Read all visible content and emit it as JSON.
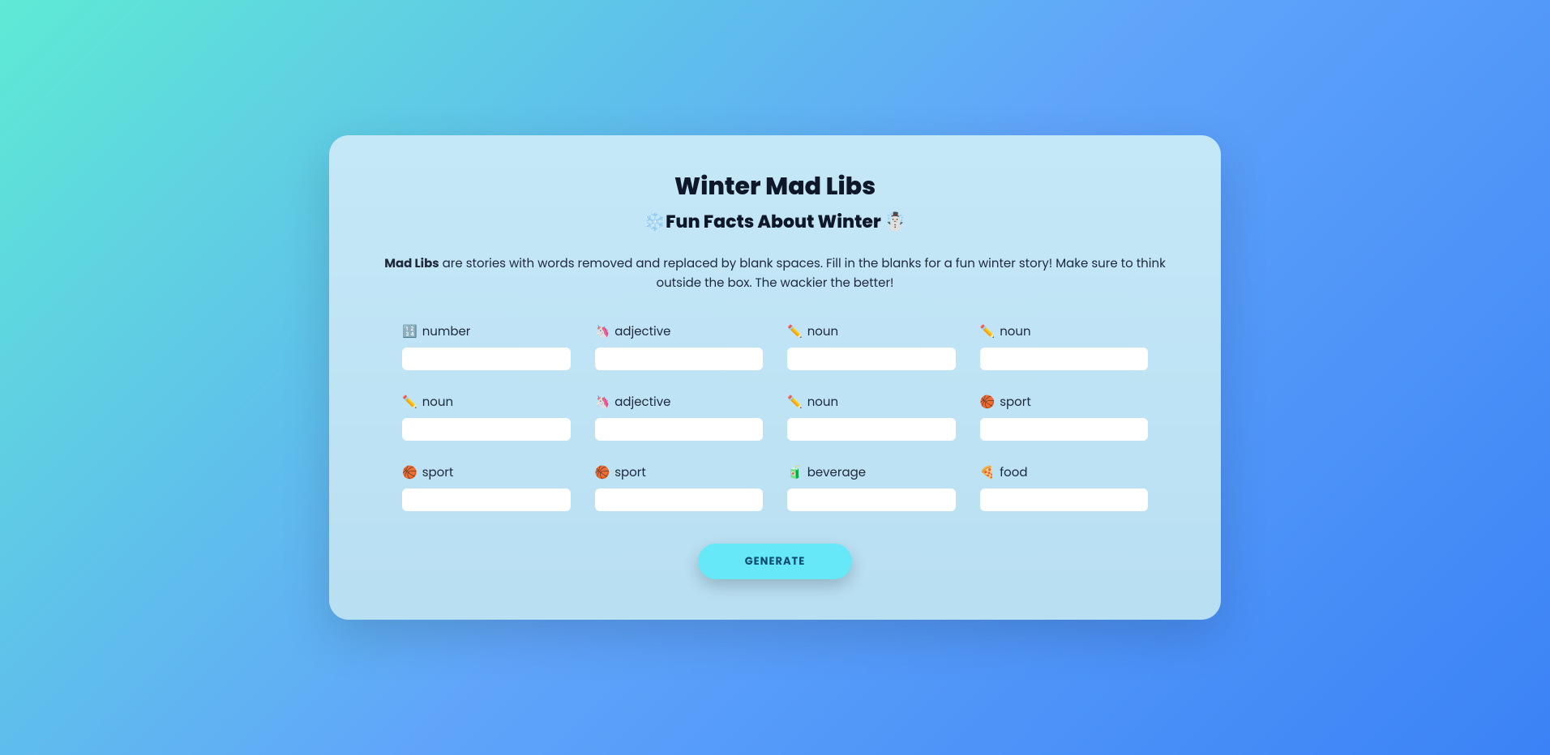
{
  "title": "Winter Mad Libs",
  "subtitle": "❄️Fun Facts About Winter ☃️",
  "description_bold": "Mad Libs",
  "description_text": " are stories with words removed and replaced by blank spaces. Fill in the blanks for a fun winter story! Make sure to think outside the box. The wackier the better!",
  "fields": [
    {
      "icon": "🔢",
      "label": "number"
    },
    {
      "icon": "🦄",
      "label": "adjective"
    },
    {
      "icon": "✏️",
      "label": "noun"
    },
    {
      "icon": "✏️",
      "label": "noun"
    },
    {
      "icon": "✏️",
      "label": "noun"
    },
    {
      "icon": "🦄",
      "label": "adjective"
    },
    {
      "icon": "✏️",
      "label": "noun"
    },
    {
      "icon": "🏀",
      "label": "sport"
    },
    {
      "icon": "🏀",
      "label": "sport"
    },
    {
      "icon": "🏀",
      "label": "sport"
    },
    {
      "icon": "🧃",
      "label": "beverage"
    },
    {
      "icon": "🍕",
      "label": "food"
    }
  ],
  "button_label": "GENERATE"
}
